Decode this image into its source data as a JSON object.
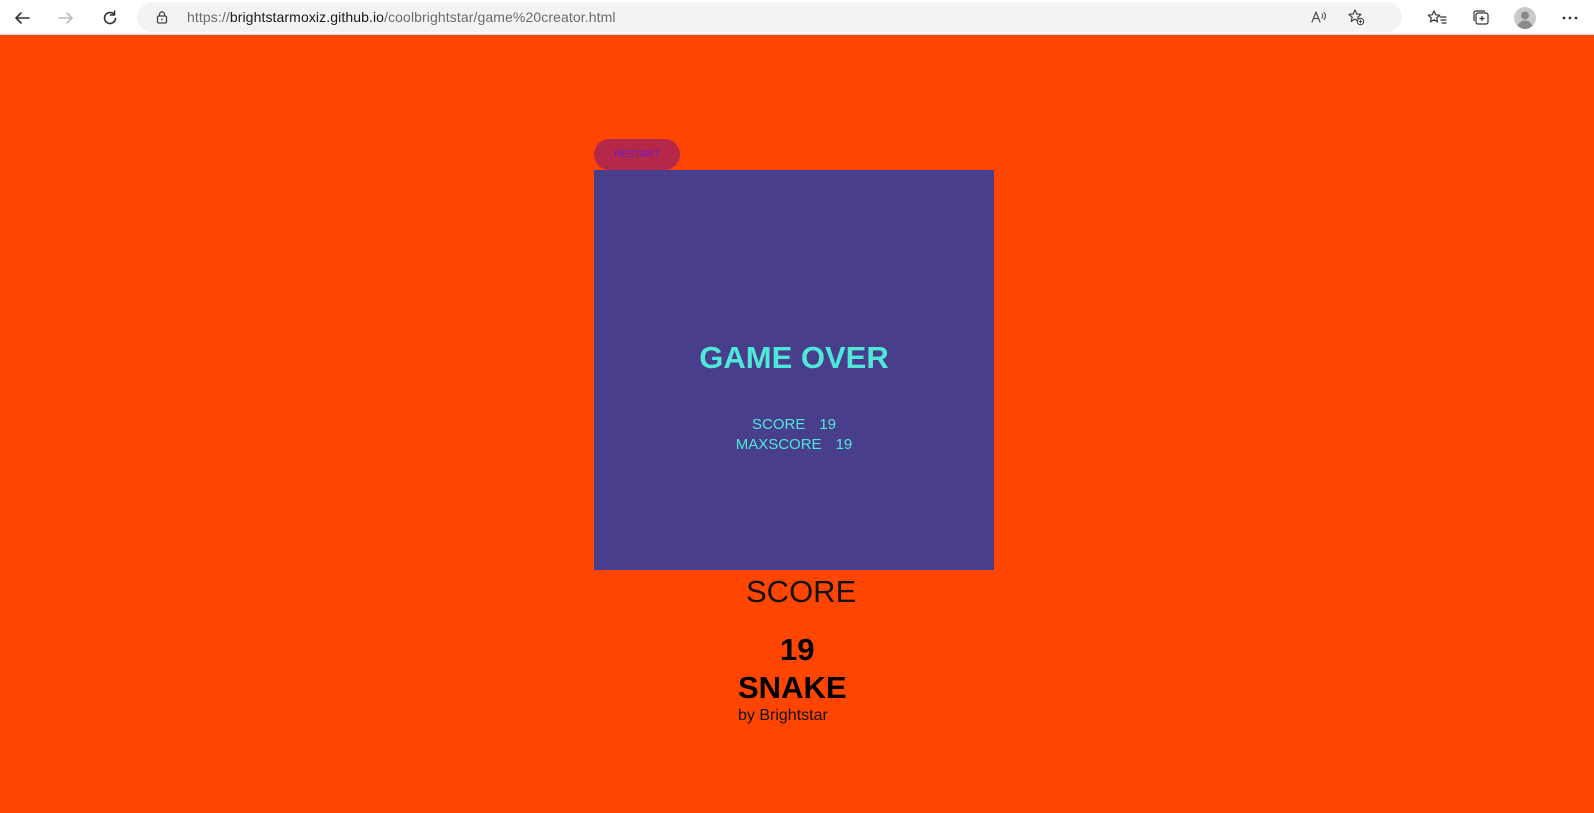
{
  "browser": {
    "url_scheme": "https://",
    "url_host": "brightstarmoxiz.github.io",
    "url_path": "/coolbrightstar/game%20creator.html",
    "icons": [
      "back-icon",
      "forward-icon",
      "refresh-icon",
      "lock-icon",
      "read-aloud-icon",
      "add-favorite-icon",
      "favorites-icon",
      "collections-icon",
      "profile-icon",
      "more-icon"
    ]
  },
  "game": {
    "restart_label": "RESTART",
    "game_over_text": "GAME OVER",
    "score_label": "SCORE",
    "score_value": "19",
    "maxscore_label": "MAXSCORE",
    "maxscore_value": "19",
    "score_heading": "SCORE",
    "score_display": "19",
    "title": "SNAKE",
    "byline": "by Brightstar"
  },
  "colors": {
    "background": "#ff4500",
    "board": "#483e8b",
    "restart_button": "#b5284a",
    "restart_text": "#6a1cc9",
    "overlay_text": "#4fe8d8"
  }
}
